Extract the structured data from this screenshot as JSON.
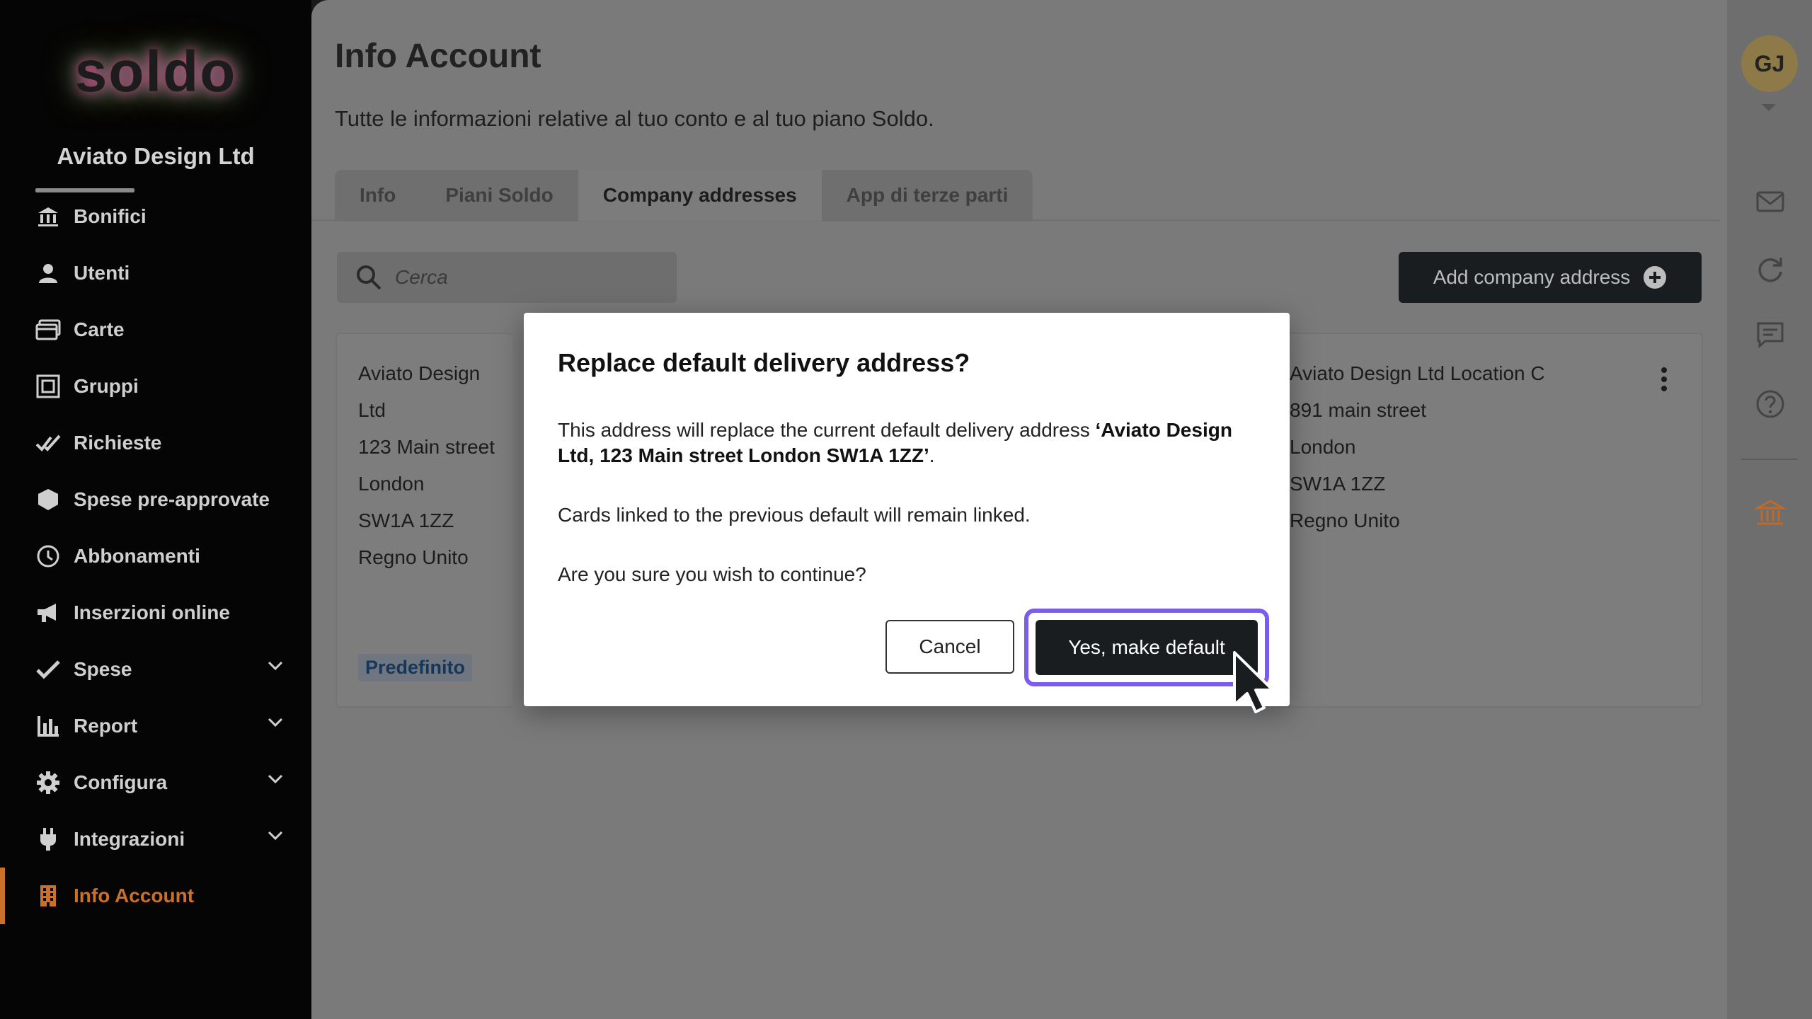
{
  "sidebar": {
    "logo": "soldo",
    "company": "Aviato Design Ltd",
    "items": [
      {
        "label": "Bonifici",
        "icon": "bank-transfer-icon"
      },
      {
        "label": "Utenti",
        "icon": "user-icon"
      },
      {
        "label": "Carte",
        "icon": "cards-icon"
      },
      {
        "label": "Gruppi",
        "icon": "groups-icon"
      },
      {
        "label": "Richieste",
        "icon": "requests-icon"
      },
      {
        "label": "Spese pre-approvate",
        "icon": "shield-icon"
      },
      {
        "label": "Abbonamenti",
        "icon": "clock-icon"
      },
      {
        "label": "Inserzioni online",
        "icon": "megaphone-icon"
      },
      {
        "label": "Spese",
        "icon": "check-icon"
      },
      {
        "label": "Report",
        "icon": "bar-chart-icon"
      },
      {
        "label": "Configura",
        "icon": "gear-icon"
      },
      {
        "label": "Integrazioni",
        "icon": "plug-icon"
      },
      {
        "label": "Info Account",
        "icon": "building-icon"
      }
    ]
  },
  "main": {
    "title": "Info Account",
    "subtitle": "Tutte le informazioni relative al tuo conto e al tuo piano Soldo.",
    "tabs": [
      {
        "label": "Info"
      },
      {
        "label": "Piani Soldo"
      },
      {
        "label": "Company addresses",
        "active": true
      },
      {
        "label": "App di terze parti"
      }
    ],
    "search_placeholder": "Cerca",
    "add_button": "Add company address",
    "cards": [
      {
        "lines": [
          "Aviato Design Ltd",
          "123 Main street",
          "London",
          "SW1A 1ZZ",
          "Regno Unito"
        ],
        "badge": "Predefinito"
      },
      {
        "lines": [
          "Aviato Design Ltd Location C",
          "891 main street",
          "London",
          "SW1A 1ZZ",
          "Regno Unito"
        ]
      }
    ]
  },
  "rail": {
    "avatar": "GJ",
    "icons": [
      "mail-icon",
      "refresh-icon",
      "chat-icon",
      "help-icon",
      "bank-icon"
    ]
  },
  "modal": {
    "title": "Replace default delivery address?",
    "body_prefix": "This address will replace the current default delivery address ",
    "body_bold": "‘Aviato Design Ltd, 123 Main street London SW1A 1ZZ’",
    "body_suffix": ".",
    "line2": "Cards linked to the previous default will remain linked.",
    "line3": "Are you sure you wish to continue?",
    "cancel": "Cancel",
    "confirm": "Yes, make default"
  },
  "colors": {
    "accent": "#c9712a",
    "focus_ring": "#7b5cf0",
    "dark_button": "#1a1d20"
  }
}
